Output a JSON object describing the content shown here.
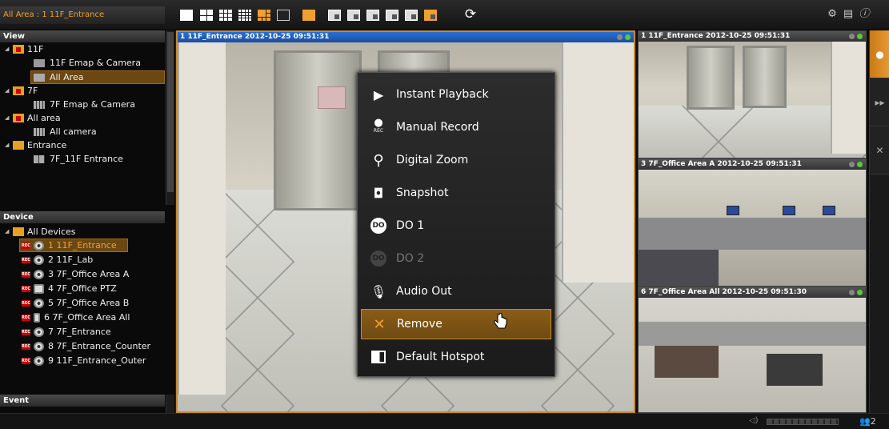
{
  "topbar": {
    "title": "All Area : 1 11F_Entrance",
    "sync_icon": "sync-icon",
    "right_icons": [
      "settings-gear-icon",
      "document-icon",
      "info-icon"
    ]
  },
  "view": {
    "header": "View",
    "items": [
      {
        "label": "11F"
      },
      {
        "label": "11F Emap & Camera"
      },
      {
        "label": "All Area"
      },
      {
        "label": "7F"
      },
      {
        "label": "7F Emap & Camera"
      },
      {
        "label": "All area"
      },
      {
        "label": "All camera"
      },
      {
        "label": "Entrance"
      },
      {
        "label": "7F_11F Entrance"
      }
    ]
  },
  "device": {
    "header": "Device",
    "root": "All Devices",
    "items": [
      {
        "label": "1 11F_Entrance"
      },
      {
        "label": "2 11F_Lab"
      },
      {
        "label": "3 7F_Office Area A"
      },
      {
        "label": "4 7F_Office PTZ"
      },
      {
        "label": "5 7F_Office Area B"
      },
      {
        "label": "6 7F_Office Area All"
      },
      {
        "label": "7 7F_Entrance"
      },
      {
        "label": "8 7F_Entrance_Counter"
      },
      {
        "label": "9 11F_Entrance_Outer"
      }
    ],
    "rec_badge": "REC"
  },
  "event": {
    "header": "Event"
  },
  "main_view": {
    "caption": "1 11F_Entrance  2012-10-25 09:51:31"
  },
  "context_menu": {
    "items": [
      {
        "label": "Instant Playback",
        "icon": "play-icon"
      },
      {
        "label": "Manual Record",
        "icon": "record-icon",
        "sub": "REC"
      },
      {
        "label": "Digital Zoom",
        "icon": "magnifier-icon"
      },
      {
        "label": "Snapshot",
        "icon": "camera-icon"
      },
      {
        "label": "DO 1",
        "icon": "do1-icon",
        "sub": "DO"
      },
      {
        "label": "DO 2",
        "icon": "do2-icon",
        "sub": "DO"
      },
      {
        "label": "Audio Out",
        "icon": "microphone-icon"
      },
      {
        "label": "Remove",
        "icon": "close-x-icon"
      },
      {
        "label": "Default Hotspot",
        "icon": "hotspot-icon"
      }
    ]
  },
  "right_views": [
    {
      "caption": "1 11F_Entrance  2012-10-25 09:51:31"
    },
    {
      "caption": "3 7F_Office Area A  2012-10-25 09:51:31"
    },
    {
      "caption": "6 7F_Office Area All  2012-10-25 09:51:30"
    }
  ],
  "statusbar": {
    "user_count": "2"
  },
  "colors": {
    "accent": "#f0a030",
    "selected_bg": "#6b4712",
    "live_dot": "#5ac840",
    "blue_header": "#2b6fd0"
  }
}
